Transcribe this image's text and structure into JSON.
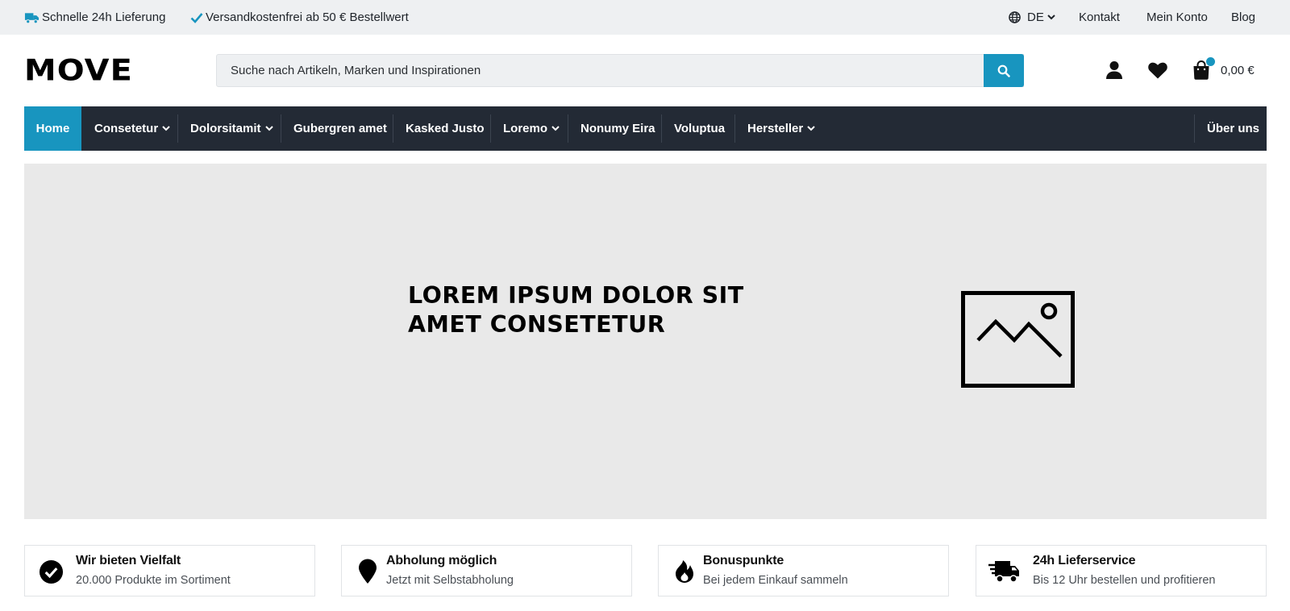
{
  "topbar": {
    "usp_delivery": "Schnelle 24h Lieferung",
    "usp_shipping": "Versandkostenfrei ab 50 € Bestellwert",
    "language": "DE",
    "links": [
      "Kontakt",
      "Mein Konto",
      "Blog"
    ]
  },
  "header": {
    "logo": "MOVE",
    "search_placeholder": "Suche nach Artikeln, Marken und Inspirationen",
    "cart_total": "0,00 €"
  },
  "nav": {
    "items": [
      {
        "label": "Home",
        "active": true,
        "dropdown": false
      },
      {
        "label": "Consetetur",
        "dropdown": true
      },
      {
        "label": "Dolorsitamit",
        "dropdown": true
      },
      {
        "label": "Gubergren amet",
        "dropdown": false
      },
      {
        "label": "Kasked Justo",
        "dropdown": false
      },
      {
        "label": "Loremo",
        "dropdown": true
      },
      {
        "label": "Nonumy Eira",
        "dropdown": false
      },
      {
        "label": "Voluptua",
        "dropdown": false
      },
      {
        "label": "Hersteller",
        "dropdown": true
      }
    ],
    "right_item": "Über uns"
  },
  "hero": {
    "title_line1": "LOREM IPSUM DOLOR SIT",
    "title_line2": "AMET CONSETETUR"
  },
  "usps": [
    {
      "icon": "check-circle-icon",
      "title": "Wir bieten Vielfalt",
      "subtitle": "20.000 Produkte im Sortiment"
    },
    {
      "icon": "map-pin-icon",
      "title": "Abholung möglich",
      "subtitle": "Jetzt mit Selbstabholung"
    },
    {
      "icon": "flame-icon",
      "title": "Bonuspunkte",
      "subtitle": "Bei jedem Einkauf sammeln"
    },
    {
      "icon": "truck-fast-icon",
      "title": "24h Lieferservice",
      "subtitle": "Bis 12 Uhr bestellen und profitieren"
    }
  ],
  "colors": {
    "accent": "#1895bf",
    "nav_bg": "#232a35",
    "topbar_bg": "#eef0f2",
    "hero_bg": "#e9e9e9"
  }
}
